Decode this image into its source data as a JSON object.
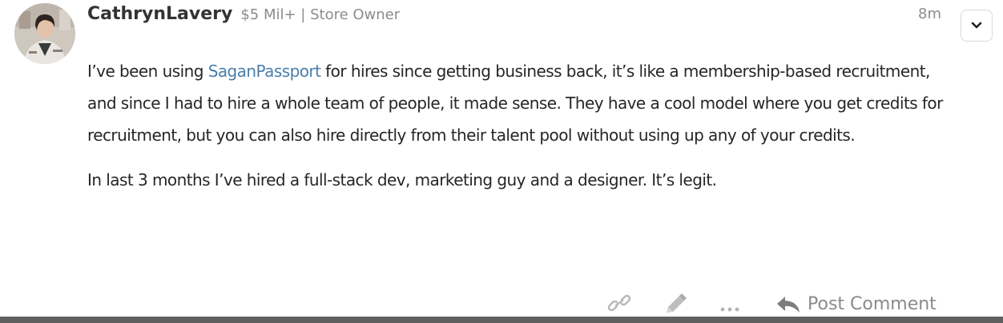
{
  "post": {
    "author": {
      "name": "CathrynLavery",
      "meta": "$5 Mil+ | Store Owner",
      "avatar_icon": "user-avatar"
    },
    "timestamp": "8m",
    "menu_icon": "chevron-down-icon",
    "body": {
      "paragraph1_before_link": "I’ve been using ",
      "paragraph1_link": "SaganPassport",
      "paragraph1_after_link": " for hires since getting business back, it’s like a membership-based recruitment, and since I had to hire a whole team of people, it made sense. They have a cool model where you get credits for recruitment, but you can also hire directly from their talent pool without using up any of your credits.",
      "paragraph2": "In last 3 months I’ve hired a full-stack dev, marketing guy and a designer. It’s legit."
    },
    "actions": {
      "link_icon": "link-icon",
      "edit_icon": "pencil-icon",
      "more_icon": "ellipsis-icon",
      "reply_icon": "reply-arrow-icon",
      "post_comment_label": "Post Comment"
    }
  },
  "colors": {
    "link": "#4a7ea9",
    "muted": "#8c8c8c",
    "text": "#262626",
    "border": "#d9d9d9",
    "footer_bar": "#5f5f5f"
  }
}
